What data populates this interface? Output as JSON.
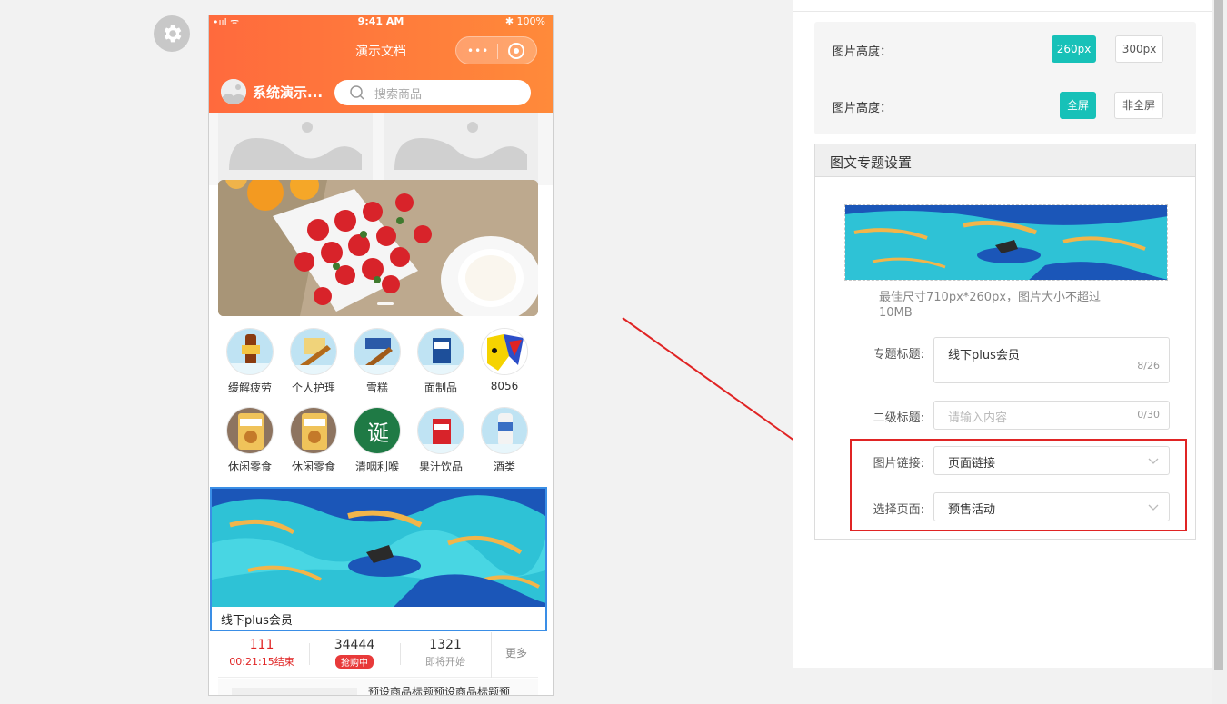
{
  "phone": {
    "status": {
      "signal": "•ııl ᯤ",
      "time": "9:41 AM",
      "battery": "✱ 100%"
    },
    "nav_title": "演示文档",
    "shop_name": "系统演示...",
    "search_placeholder": "搜索商品",
    "categories_row1": [
      "缓解疲劳",
      "个人护理",
      "雪糕",
      "面制品",
      "8056"
    ],
    "categories_row2": [
      "休闲零食",
      "休闲零食",
      "清咽利喉",
      "果汁饮品",
      "酒类"
    ],
    "article_title": "线下plus会员",
    "flash": {
      "col1_value": "111",
      "col1_sub": "00:21:15结束",
      "col2_value": "34444",
      "col2_badge": "抢购中",
      "col3_value": "1321",
      "col3_sub": "即将开始",
      "more": "更多"
    },
    "goods_title": "预设商品标题预设商品标题预"
  },
  "panel": {
    "height_label_1": "图片高度：",
    "height_opt_1": "260px",
    "height_opt_2": "300px",
    "height_label_2": "图片高度：",
    "screen_opt_1": "全屏",
    "screen_opt_2": "非全屏",
    "section_title": "图文专题设置",
    "hint": "最佳尺寸710px*260px，图片大小不超过10MB",
    "topic_title_label": "专题标题:",
    "topic_title_value": "线下plus会员",
    "topic_title_count": "8/26",
    "subtitle_label": "二级标题:",
    "subtitle_placeholder": "请输入内容",
    "subtitle_count": "0/30",
    "link_label": "图片链接:",
    "link_value": "页面链接",
    "page_label": "选择页面:",
    "page_value": "预售活动"
  },
  "colors": {
    "accent": "#17c1b8",
    "brand_orange": "#ff6a3d",
    "highlight_red": "#e02424",
    "selection_blue": "#3a8ee6"
  }
}
